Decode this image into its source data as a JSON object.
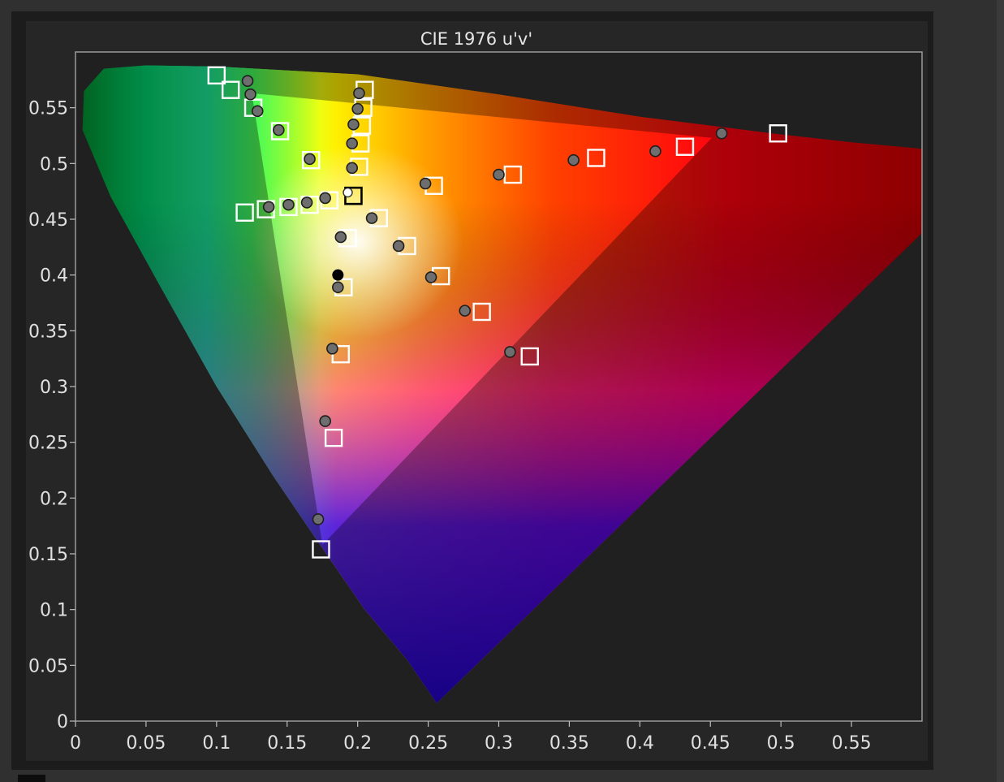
{
  "chart_data": {
    "type": "scatter",
    "title": "CIE 1976 u'v'",
    "xlabel": "",
    "ylabel": "",
    "xlim": [
      0,
      0.6
    ],
    "ylim": [
      0,
      0.6
    ],
    "grid": false,
    "background": "CIE 1976 chromaticity diagram with gamut triangle",
    "x_ticks": [
      "0",
      "0.05",
      "0.1",
      "0.15",
      "0.2",
      "0.25",
      "0.3",
      "0.35",
      "0.4",
      "0.45",
      "0.5",
      "0.55"
    ],
    "x_tick_values": [
      0,
      0.05,
      0.1,
      0.15,
      0.2,
      0.25,
      0.3,
      0.35,
      0.4,
      0.45,
      0.5,
      0.55
    ],
    "y_ticks": [
      "0",
      "0.05",
      "0.1",
      "0.15",
      "0.2",
      "0.25",
      "0.3",
      "0.35",
      "0.4",
      "0.45",
      "0.5",
      "0.55"
    ],
    "y_tick_values": [
      0,
      0.05,
      0.1,
      0.15,
      0.2,
      0.25,
      0.3,
      0.35,
      0.4,
      0.45,
      0.5,
      0.55
    ],
    "gamut_triangle": [
      [
        0.451,
        0.523
      ],
      [
        0.125,
        0.563
      ],
      [
        0.175,
        0.158
      ]
    ],
    "series": [
      {
        "marker": "square",
        "points": [
          [
            0.1,
            0.579
          ],
          [
            0.11,
            0.566
          ],
          [
            0.126,
            0.55
          ],
          [
            0.145,
            0.529
          ],
          [
            0.167,
            0.503
          ],
          [
            0.205,
            0.566
          ],
          [
            0.204,
            0.55
          ],
          [
            0.203,
            0.534
          ],
          [
            0.202,
            0.518
          ],
          [
            0.201,
            0.497
          ],
          [
            0.498,
            0.527
          ],
          [
            0.432,
            0.515
          ],
          [
            0.369,
            0.505
          ],
          [
            0.31,
            0.49
          ],
          [
            0.254,
            0.48
          ],
          [
            0.12,
            0.456
          ],
          [
            0.135,
            0.459
          ],
          [
            0.151,
            0.461
          ],
          [
            0.166,
            0.463
          ],
          [
            0.18,
            0.467
          ],
          [
            0.215,
            0.451
          ],
          [
            0.235,
            0.426
          ],
          [
            0.259,
            0.399
          ],
          [
            0.288,
            0.367
          ],
          [
            0.322,
            0.327
          ],
          [
            0.193,
            0.433
          ],
          [
            0.19,
            0.389
          ],
          [
            0.188,
            0.329
          ],
          [
            0.183,
            0.254
          ],
          [
            0.174,
            0.154
          ]
        ]
      },
      {
        "marker": "circle",
        "points": [
          [
            0.122,
            0.574
          ],
          [
            0.124,
            0.562
          ],
          [
            0.129,
            0.547
          ],
          [
            0.144,
            0.53
          ],
          [
            0.166,
            0.504
          ],
          [
            0.201,
            0.563
          ],
          [
            0.2,
            0.549
          ],
          [
            0.197,
            0.535
          ],
          [
            0.196,
            0.518
          ],
          [
            0.196,
            0.496
          ],
          [
            0.458,
            0.527
          ],
          [
            0.411,
            0.511
          ],
          [
            0.353,
            0.503
          ],
          [
            0.3,
            0.49
          ],
          [
            0.248,
            0.482
          ],
          [
            0.137,
            0.461
          ],
          [
            0.151,
            0.463
          ],
          [
            0.164,
            0.465
          ],
          [
            0.177,
            0.469
          ],
          [
            0.21,
            0.451
          ],
          [
            0.229,
            0.426
          ],
          [
            0.252,
            0.398
          ],
          [
            0.276,
            0.368
          ],
          [
            0.308,
            0.331
          ],
          [
            0.188,
            0.434
          ],
          [
            0.186,
            0.389
          ],
          [
            0.182,
            0.334
          ],
          [
            0.177,
            0.269
          ],
          [
            0.172,
            0.181
          ]
        ]
      },
      {
        "marker": "square-black",
        "points": [
          [
            0.197,
            0.471
          ]
        ]
      },
      {
        "marker": "circle-white",
        "points": [
          [
            0.193,
            0.474
          ]
        ]
      },
      {
        "marker": "circle-black",
        "points": [
          [
            0.186,
            0.4
          ]
        ]
      }
    ]
  }
}
